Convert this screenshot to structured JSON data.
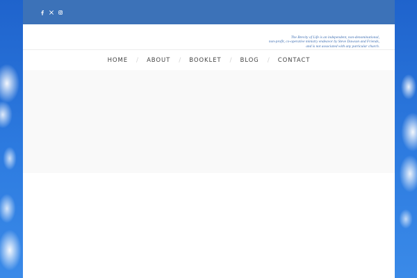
{
  "colors": {
    "topbar": "#3c72b8",
    "tagline": "#3f6fb3",
    "nav_text": "#444444",
    "hero_bg": "#f9f9f9",
    "sky": "#2a73d6"
  },
  "social": [
    {
      "icon": "facebook-icon"
    },
    {
      "icon": "x-twitter-icon"
    },
    {
      "icon": "instagram-icon"
    }
  ],
  "header": {
    "tagline_lines": [
      "The Brevity of Life is an independent, non-denominational,",
      "non-profit, co-operative ministry endeavor by Steve Dawson and Friends,",
      "and is not associated with any particular church."
    ]
  },
  "nav": {
    "items": [
      {
        "label": "HOME"
      },
      {
        "label": "ABOUT"
      },
      {
        "label": "BOOKLET"
      },
      {
        "label": "BLOG"
      },
      {
        "label": "CONTACT"
      }
    ],
    "separator": "/"
  }
}
